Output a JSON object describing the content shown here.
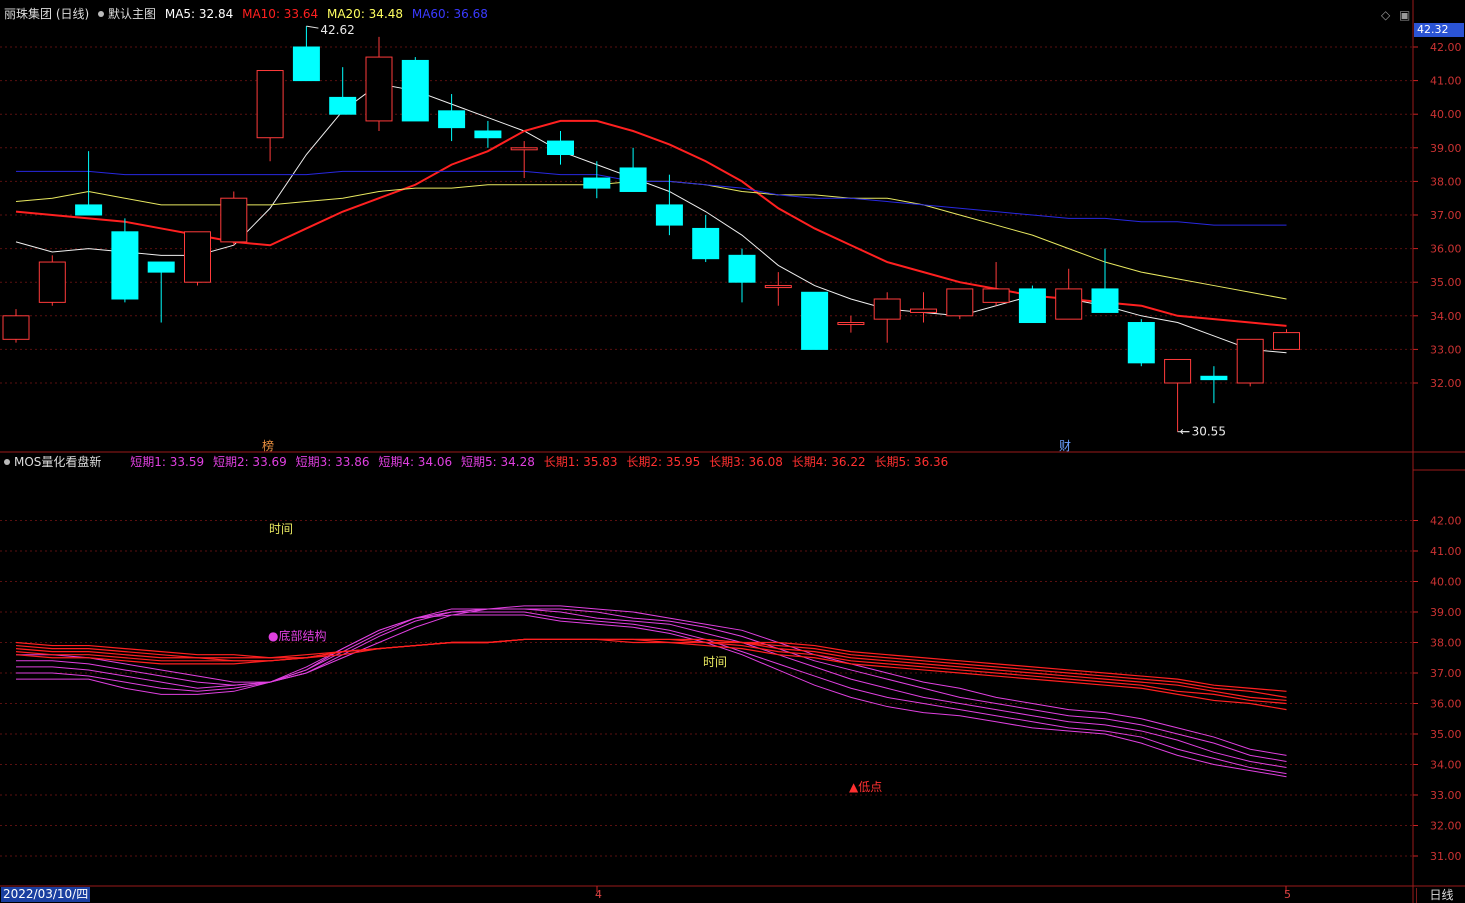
{
  "header": {
    "stock_title": "丽珠集团 (日线)",
    "template_label": "默认主图",
    "ma5": "MA5: 32.84",
    "ma10": "MA10: 33.64",
    "ma20": "MA20: 34.48",
    "ma60": "MA60: 36.68",
    "colors": {
      "ma5": "#ffffff",
      "ma10": "#ff2020",
      "ma20": "#ffff60",
      "ma60": "#3a3aff"
    }
  },
  "current_price_tag": "42.32",
  "main_axis_labels": [
    "42.00",
    "41.00",
    "40.00",
    "39.00",
    "38.00",
    "37.00",
    "36.00",
    "35.00",
    "34.00",
    "33.00",
    "32.00"
  ],
  "main_annotations": {
    "high": "42.62",
    "low": "30.55",
    "event_left": "榜",
    "event_right": "财"
  },
  "indicator": {
    "name": "MOS量化看盘新",
    "short_labels": [
      "短期1: 33.59",
      "短期2: 33.69",
      "短期3: 33.86",
      "短期4: 34.06",
      "短期5: 34.28"
    ],
    "long_labels": [
      "长期1: 35.83",
      "长期2: 35.95",
      "长期3: 36.08",
      "长期4: 36.22",
      "长期5: 36.36"
    ],
    "axis_labels": [
      "42.00",
      "41.00",
      "40.00",
      "39.00",
      "38.00",
      "37.00",
      "36.00",
      "35.00",
      "34.00",
      "33.00",
      "32.00",
      "31.00"
    ],
    "annotations": {
      "time1": "时间",
      "time2": "时间",
      "bottom": "●底部结构",
      "low": "▲低点"
    },
    "colors": {
      "short": "#e040e0",
      "long": "#ff2020"
    }
  },
  "footer": {
    "date": "2022/03/10/四",
    "month_a": "4",
    "month_b": "5",
    "timeframe": "日线"
  },
  "chart_data": [
    {
      "type": "candlestick",
      "title": "丽珠集团 (日线)",
      "ylim": [
        30.5,
        42.4
      ],
      "candles": [
        {
          "o": 33.3,
          "h": 34.2,
          "l": 33.2,
          "c": 34.0
        },
        {
          "o": 34.4,
          "h": 35.8,
          "l": 34.3,
          "c": 35.6
        },
        {
          "o": 37.3,
          "h": 38.9,
          "l": 37.0,
          "c": 37.0
        },
        {
          "o": 36.5,
          "h": 36.9,
          "l": 34.4,
          "c": 34.5
        },
        {
          "o": 35.6,
          "h": 35.6,
          "l": 33.8,
          "c": 35.3
        },
        {
          "o": 35.0,
          "h": 36.5,
          "l": 34.9,
          "c": 36.5
        },
        {
          "o": 36.2,
          "h": 37.7,
          "l": 36.1,
          "c": 37.5
        },
        {
          "o": 39.3,
          "h": 41.3,
          "l": 38.6,
          "c": 41.3
        },
        {
          "o": 42.0,
          "h": 42.62,
          "l": 41.0,
          "c": 41.0
        },
        {
          "o": 40.5,
          "h": 41.4,
          "l": 40.0,
          "c": 40.0
        },
        {
          "o": 39.8,
          "h": 42.3,
          "l": 39.5,
          "c": 41.7
        },
        {
          "o": 41.6,
          "h": 41.7,
          "l": 39.8,
          "c": 39.8
        },
        {
          "o": 40.1,
          "h": 40.6,
          "l": 39.2,
          "c": 39.6
        },
        {
          "o": 39.5,
          "h": 39.8,
          "l": 39.0,
          "c": 39.3
        },
        {
          "o": 39.0,
          "h": 39.2,
          "l": 38.1,
          "c": 39.0
        },
        {
          "o": 39.2,
          "h": 39.5,
          "l": 38.5,
          "c": 38.8
        },
        {
          "o": 38.1,
          "h": 38.6,
          "l": 37.5,
          "c": 37.8
        },
        {
          "o": 38.4,
          "h": 39.0,
          "l": 37.7,
          "c": 37.7
        },
        {
          "o": 37.3,
          "h": 38.2,
          "l": 36.4,
          "c": 36.7
        },
        {
          "o": 36.6,
          "h": 37.0,
          "l": 35.6,
          "c": 35.7
        },
        {
          "o": 35.8,
          "h": 36.0,
          "l": 34.4,
          "c": 35.0
        },
        {
          "o": 34.9,
          "h": 35.3,
          "l": 34.3,
          "c": 34.9
        },
        {
          "o": 34.7,
          "h": 34.7,
          "l": 33.0,
          "c": 33.0
        },
        {
          "o": 33.8,
          "h": 34.0,
          "l": 33.5,
          "c": 33.8
        },
        {
          "o": 33.9,
          "h": 34.7,
          "l": 33.2,
          "c": 34.5
        },
        {
          "o": 34.1,
          "h": 34.7,
          "l": 33.8,
          "c": 34.2
        },
        {
          "o": 34.0,
          "h": 34.8,
          "l": 33.9,
          "c": 34.8
        },
        {
          "o": 34.4,
          "h": 35.6,
          "l": 34.3,
          "c": 34.8
        },
        {
          "o": 34.8,
          "h": 34.9,
          "l": 33.8,
          "c": 33.8
        },
        {
          "o": 33.9,
          "h": 35.4,
          "l": 33.9,
          "c": 34.8
        },
        {
          "o": 34.8,
          "h": 36.0,
          "l": 34.1,
          "c": 34.1
        },
        {
          "o": 33.8,
          "h": 33.9,
          "l": 32.5,
          "c": 32.6
        },
        {
          "o": 32.0,
          "h": 32.7,
          "l": 30.55,
          "c": 32.7
        },
        {
          "o": 32.2,
          "h": 32.5,
          "l": 31.4,
          "c": 32.1
        },
        {
          "o": 32.0,
          "h": 33.3,
          "l": 31.9,
          "c": 33.3
        },
        {
          "o": 33.0,
          "h": 33.6,
          "l": 33.0,
          "c": 33.5
        }
      ],
      "series": [
        {
          "name": "MA5",
          "values": [
            36.2,
            35.9,
            36.0,
            35.9,
            35.8,
            35.8,
            36.1,
            37.2,
            38.8,
            40.1,
            40.9,
            40.7,
            40.3,
            39.9,
            39.5,
            38.9,
            38.5,
            38.1,
            37.7,
            37.1,
            36.4,
            35.5,
            34.9,
            34.5,
            34.2,
            34.1,
            34.0,
            34.3,
            34.6,
            34.5,
            34.3,
            34.0,
            33.8,
            33.4,
            33.0,
            32.9
          ]
        },
        {
          "name": "MA10",
          "values": [
            37.1,
            37.0,
            36.9,
            36.8,
            36.6,
            36.4,
            36.2,
            36.1,
            36.6,
            37.1,
            37.5,
            37.9,
            38.5,
            38.9,
            39.5,
            39.8,
            39.8,
            39.5,
            39.1,
            38.6,
            38.0,
            37.2,
            36.6,
            36.1,
            35.6,
            35.3,
            35.0,
            34.8,
            34.6,
            34.5,
            34.4,
            34.3,
            34.0,
            33.9,
            33.8,
            33.7
          ]
        },
        {
          "name": "MA20",
          "values": [
            37.4,
            37.5,
            37.7,
            37.5,
            37.3,
            37.3,
            37.3,
            37.3,
            37.4,
            37.5,
            37.7,
            37.8,
            37.8,
            37.9,
            37.9,
            37.9,
            37.9,
            38.0,
            38.0,
            37.9,
            37.7,
            37.6,
            37.6,
            37.5,
            37.5,
            37.3,
            37.0,
            36.7,
            36.4,
            36.0,
            35.6,
            35.3,
            35.1,
            34.9,
            34.7,
            34.5
          ]
        },
        {
          "name": "MA60",
          "values": [
            38.3,
            38.3,
            38.3,
            38.2,
            38.2,
            38.2,
            38.2,
            38.2,
            38.2,
            38.3,
            38.3,
            38.3,
            38.3,
            38.3,
            38.3,
            38.2,
            38.2,
            38.0,
            38.0,
            37.9,
            37.8,
            37.6,
            37.5,
            37.5,
            37.4,
            37.3,
            37.2,
            37.1,
            37.0,
            36.9,
            36.9,
            36.8,
            36.8,
            36.7,
            36.7,
            36.7
          ]
        }
      ]
    },
    {
      "type": "line",
      "title": "MOS量化看盘新",
      "ylim": [
        30.5,
        42.5
      ],
      "series": [
        {
          "name": "短期1",
          "values": [
            36.8,
            36.8,
            36.8,
            36.5,
            36.3,
            36.3,
            36.4,
            36.7,
            37.1,
            37.8,
            38.4,
            38.8,
            38.9,
            38.9,
            38.9,
            38.7,
            38.6,
            38.5,
            38.3,
            38.0,
            37.6,
            37.1,
            36.6,
            36.2,
            35.9,
            35.7,
            35.6,
            35.4,
            35.2,
            35.1,
            35.0,
            34.7,
            34.3,
            34.0,
            33.8,
            33.6
          ]
        },
        {
          "name": "短期2",
          "values": [
            37.0,
            37.0,
            36.9,
            36.7,
            36.5,
            36.4,
            36.5,
            36.7,
            37.2,
            37.8,
            38.4,
            38.8,
            39.0,
            39.0,
            39.0,
            38.8,
            38.7,
            38.6,
            38.4,
            38.1,
            37.7,
            37.3,
            36.9,
            36.5,
            36.2,
            36.0,
            35.8,
            35.6,
            35.4,
            35.2,
            35.1,
            34.9,
            34.5,
            34.2,
            33.9,
            33.7
          ]
        },
        {
          "name": "短期3",
          "values": [
            37.2,
            37.2,
            37.1,
            36.9,
            36.7,
            36.5,
            36.6,
            36.7,
            37.1,
            37.7,
            38.3,
            38.8,
            39.1,
            39.1,
            39.1,
            39.0,
            38.8,
            38.7,
            38.6,
            38.3,
            38.0,
            37.6,
            37.2,
            36.8,
            36.5,
            36.2,
            36.0,
            35.8,
            35.6,
            35.4,
            35.3,
            35.1,
            34.8,
            34.4,
            34.1,
            33.9
          ]
        },
        {
          "name": "短期4",
          "values": [
            37.4,
            37.4,
            37.3,
            37.1,
            36.9,
            36.7,
            36.6,
            36.7,
            37.0,
            37.6,
            38.2,
            38.7,
            39.0,
            39.1,
            39.1,
            39.1,
            39.0,
            38.8,
            38.7,
            38.5,
            38.2,
            37.8,
            37.4,
            37.1,
            36.8,
            36.5,
            36.2,
            36.0,
            35.8,
            35.6,
            35.5,
            35.3,
            35.0,
            34.7,
            34.3,
            34.1
          ]
        },
        {
          "name": "短期5",
          "values": [
            37.6,
            37.6,
            37.5,
            37.3,
            37.1,
            36.9,
            36.7,
            36.7,
            37.0,
            37.5,
            38.0,
            38.5,
            38.9,
            39.1,
            39.2,
            39.2,
            39.1,
            39.0,
            38.8,
            38.6,
            38.4,
            38.0,
            37.6,
            37.3,
            37.0,
            36.7,
            36.5,
            36.2,
            36.0,
            35.8,
            35.7,
            35.5,
            35.2,
            34.9,
            34.5,
            34.3
          ]
        },
        {
          "name": "长期1",
          "values": [
            37.6,
            37.5,
            37.5,
            37.4,
            37.3,
            37.3,
            37.3,
            37.4,
            37.5,
            37.6,
            37.8,
            37.9,
            38.0,
            38.0,
            38.1,
            38.1,
            38.1,
            38.0,
            38.0,
            37.9,
            37.8,
            37.6,
            37.5,
            37.3,
            37.2,
            37.1,
            37.0,
            36.9,
            36.8,
            36.7,
            36.6,
            36.5,
            36.3,
            36.1,
            36.0,
            35.8
          ]
        },
        {
          "name": "长期2",
          "values": [
            37.7,
            37.6,
            37.6,
            37.5,
            37.4,
            37.4,
            37.4,
            37.4,
            37.5,
            37.7,
            37.8,
            37.9,
            38.0,
            38.0,
            38.1,
            38.1,
            38.1,
            38.1,
            38.0,
            38.0,
            37.9,
            37.7,
            37.6,
            37.4,
            37.3,
            37.2,
            37.1,
            37.0,
            36.9,
            36.8,
            36.7,
            36.6,
            36.4,
            36.3,
            36.1,
            36.0
          ]
        },
        {
          "name": "长期3",
          "values": [
            37.8,
            37.7,
            37.7,
            37.6,
            37.5,
            37.5,
            37.4,
            37.4,
            37.5,
            37.7,
            37.8,
            37.9,
            38.0,
            38.0,
            38.1,
            38.1,
            38.1,
            38.1,
            38.1,
            38.0,
            38.0,
            37.8,
            37.7,
            37.5,
            37.4,
            37.3,
            37.2,
            37.1,
            37.0,
            36.9,
            36.8,
            36.7,
            36.6,
            36.4,
            36.2,
            36.1
          ]
        },
        {
          "name": "长期4",
          "values": [
            37.9,
            37.8,
            37.8,
            37.7,
            37.6,
            37.5,
            37.5,
            37.5,
            37.5,
            37.7,
            37.8,
            37.9,
            38.0,
            38.0,
            38.1,
            38.1,
            38.1,
            38.1,
            38.1,
            38.1,
            38.0,
            37.9,
            37.8,
            37.6,
            37.5,
            37.4,
            37.3,
            37.2,
            37.1,
            37.0,
            36.9,
            36.8,
            36.7,
            36.5,
            36.4,
            36.2
          ]
        },
        {
          "name": "长期5",
          "values": [
            38.0,
            37.9,
            37.9,
            37.8,
            37.7,
            37.6,
            37.6,
            37.5,
            37.6,
            37.7,
            37.8,
            37.9,
            38.0,
            38.0,
            38.1,
            38.1,
            38.1,
            38.1,
            38.1,
            38.1,
            38.0,
            38.0,
            37.9,
            37.7,
            37.6,
            37.5,
            37.4,
            37.3,
            37.2,
            37.1,
            37.0,
            36.9,
            36.8,
            36.6,
            36.5,
            36.4
          ]
        }
      ]
    }
  ]
}
